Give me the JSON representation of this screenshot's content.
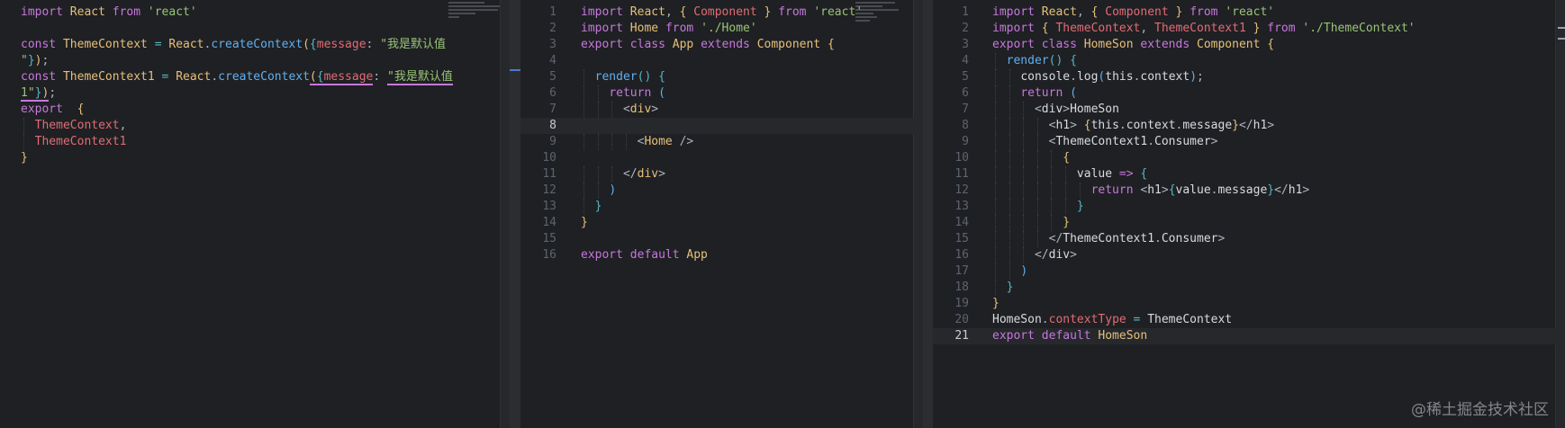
{
  "pane1": {
    "lines": [
      {
        "n": "",
        "seg": [
          [
            "k",
            "import "
          ],
          [
            "i",
            "React "
          ],
          [
            "k",
            "from "
          ],
          [
            "s",
            "'react'"
          ]
        ]
      },
      {
        "n": "",
        "seg": []
      },
      {
        "n": "",
        "seg": [
          [
            "k",
            "const "
          ],
          [
            "i",
            "ThemeContext "
          ],
          [
            "o",
            "= "
          ],
          [
            "i",
            "React"
          ],
          [
            "w",
            "."
          ],
          [
            "f",
            "createContext"
          ],
          [
            "p",
            "("
          ],
          [
            "b",
            "{"
          ],
          [
            "v",
            "message"
          ],
          [
            "w",
            ": "
          ],
          [
            "s",
            "\"我是默认值"
          ]
        ]
      },
      {
        "n": "",
        "seg": [
          [
            "s",
            "\""
          ],
          [
            "b",
            "}"
          ],
          [
            "p",
            ")"
          ],
          [
            "w",
            ";"
          ]
        ]
      },
      {
        "n": "",
        "seg": [
          [
            "k",
            "const "
          ],
          [
            "i",
            "ThemeContext1 "
          ],
          [
            "o",
            "= "
          ],
          [
            "i",
            "React"
          ],
          [
            "w",
            "."
          ],
          [
            "f",
            "createContext"
          ],
          [
            "p",
            "("
          ],
          [
            "b",
            "{"
          ],
          [
            "v",
            "message"
          ],
          [
            "w",
            ": "
          ],
          [
            "s",
            "\"我是默认值"
          ]
        ]
      },
      {
        "n": "",
        "seg": [
          [
            "s",
            "1\""
          ],
          [
            "b",
            "}"
          ],
          [
            "p",
            ")"
          ],
          [
            "w",
            ";"
          ]
        ]
      },
      {
        "n": "",
        "seg": [
          [
            "k",
            "export "
          ],
          [
            "w",
            " "
          ],
          [
            "p",
            "{"
          ]
        ]
      },
      {
        "n": "",
        "seg": [
          [
            "w",
            "  "
          ],
          [
            "v",
            "ThemeContext"
          ],
          [
            "w",
            ","
          ]
        ]
      },
      {
        "n": "",
        "seg": [
          [
            "w",
            "  "
          ],
          [
            "v",
            "ThemeContext1"
          ]
        ]
      },
      {
        "n": "",
        "seg": [
          [
            "p",
            "}"
          ]
        ]
      }
    ]
  },
  "pane2": {
    "lines": [
      {
        "n": "1",
        "seg": [
          [
            "k",
            "import "
          ],
          [
            "i",
            "React"
          ],
          [
            "w",
            ", "
          ],
          [
            "p",
            "{ "
          ],
          [
            "v",
            "Component "
          ],
          [
            "p",
            "} "
          ],
          [
            "k",
            "from "
          ],
          [
            "s",
            "'react'"
          ]
        ]
      },
      {
        "n": "2",
        "seg": [
          [
            "k",
            "import "
          ],
          [
            "i",
            "Home "
          ],
          [
            "k",
            "from "
          ],
          [
            "s",
            "'./Home'"
          ]
        ]
      },
      {
        "n": "3",
        "seg": [
          [
            "k",
            "export class "
          ],
          [
            "i",
            "App "
          ],
          [
            "k",
            "extends "
          ],
          [
            "i",
            "Component "
          ],
          [
            "p",
            "{"
          ]
        ]
      },
      {
        "n": "4",
        "seg": []
      },
      {
        "n": "5",
        "seg": [
          [
            "w",
            "  "
          ],
          [
            "f",
            "render"
          ],
          [
            "b",
            "() "
          ],
          [
            "b",
            "{"
          ]
        ]
      },
      {
        "n": "6",
        "seg": [
          [
            "w",
            "    "
          ],
          [
            "k",
            "return "
          ],
          [
            "f",
            "("
          ]
        ]
      },
      {
        "n": "7",
        "seg": [
          [
            "w",
            "      "
          ],
          [
            "w",
            "<"
          ],
          [
            "i",
            "div"
          ],
          [
            "w",
            ">"
          ]
        ]
      },
      {
        "n": "8",
        "seg": []
      },
      {
        "n": "9",
        "seg": [
          [
            "w",
            "        "
          ],
          [
            "w",
            "<"
          ],
          [
            "i",
            "Home "
          ],
          [
            "w",
            "/>"
          ]
        ]
      },
      {
        "n": "10",
        "seg": []
      },
      {
        "n": "11",
        "seg": [
          [
            "w",
            "      "
          ],
          [
            "w",
            "</"
          ],
          [
            "i",
            "div"
          ],
          [
            "w",
            ">"
          ]
        ]
      },
      {
        "n": "12",
        "seg": [
          [
            "w",
            "    "
          ],
          [
            "f",
            ")"
          ]
        ]
      },
      {
        "n": "13",
        "seg": [
          [
            "w",
            "  "
          ],
          [
            "b",
            "}"
          ]
        ]
      },
      {
        "n": "14",
        "seg": [
          [
            "p",
            "}"
          ]
        ]
      },
      {
        "n": "15",
        "seg": []
      },
      {
        "n": "16",
        "seg": [
          [
            "k",
            "export default "
          ],
          [
            "i",
            "App"
          ]
        ]
      }
    ],
    "current_line": 8
  },
  "pane3": {
    "lines": [
      {
        "n": "1",
        "seg": [
          [
            "k",
            "import "
          ],
          [
            "i",
            "React"
          ],
          [
            "w",
            ", "
          ],
          [
            "p",
            "{ "
          ],
          [
            "v",
            "Component "
          ],
          [
            "p",
            "} "
          ],
          [
            "k",
            "from "
          ],
          [
            "s",
            "'react'"
          ]
        ]
      },
      {
        "n": "2",
        "seg": [
          [
            "k",
            "import "
          ],
          [
            "p",
            "{ "
          ],
          [
            "v",
            "ThemeContext"
          ],
          [
            "w",
            ", "
          ],
          [
            "v",
            "ThemeContext1 "
          ],
          [
            "p",
            "} "
          ],
          [
            "k",
            "from "
          ],
          [
            "s",
            "'./ThemeContext'"
          ]
        ]
      },
      {
        "n": "3",
        "seg": [
          [
            "k",
            "export class "
          ],
          [
            "i",
            "HomeSon "
          ],
          [
            "k",
            "extends "
          ],
          [
            "i",
            "Component "
          ],
          [
            "p",
            "{"
          ]
        ]
      },
      {
        "n": "4",
        "seg": [
          [
            "w",
            "  "
          ],
          [
            "f",
            "render"
          ],
          [
            "b",
            "() "
          ],
          [
            "b",
            "{"
          ]
        ]
      },
      {
        "n": "5",
        "seg": [
          [
            "w",
            "    "
          ],
          [
            "t",
            "console"
          ],
          [
            "w",
            "."
          ],
          [
            "t",
            "log"
          ],
          [
            "f",
            "("
          ],
          [
            "t",
            "this"
          ],
          [
            "w",
            "."
          ],
          [
            "t",
            "context"
          ],
          [
            "f",
            ")"
          ],
          [
            "w",
            ";"
          ]
        ]
      },
      {
        "n": "6",
        "seg": [
          [
            "w",
            "    "
          ],
          [
            "k",
            "return "
          ],
          [
            "f",
            "("
          ]
        ]
      },
      {
        "n": "7",
        "seg": [
          [
            "w",
            "      "
          ],
          [
            "w",
            "<"
          ],
          [
            "t",
            "div"
          ],
          [
            "w",
            ">"
          ],
          [
            "t",
            "HomeSon"
          ]
        ]
      },
      {
        "n": "8",
        "seg": [
          [
            "w",
            "        "
          ],
          [
            "w",
            "<"
          ],
          [
            "t",
            "h1"
          ],
          [
            "w",
            "> "
          ],
          [
            "p",
            "{"
          ],
          [
            "t",
            "this"
          ],
          [
            "w",
            "."
          ],
          [
            "t",
            "context"
          ],
          [
            "w",
            "."
          ],
          [
            "t",
            "message"
          ],
          [
            "p",
            "}"
          ],
          [
            "w",
            "</"
          ],
          [
            "t",
            "h1"
          ],
          [
            "w",
            ">"
          ]
        ]
      },
      {
        "n": "9",
        "seg": [
          [
            "w",
            "        "
          ],
          [
            "w",
            "<"
          ],
          [
            "t",
            "ThemeContext1"
          ],
          [
            "w",
            "."
          ],
          [
            "t",
            "Consumer"
          ],
          [
            "w",
            ">"
          ]
        ]
      },
      {
        "n": "10",
        "seg": [
          [
            "w",
            "          "
          ],
          [
            "p",
            "{"
          ]
        ]
      },
      {
        "n": "11",
        "seg": [
          [
            "w",
            "            "
          ],
          [
            "t",
            "value "
          ],
          [
            "k",
            "=> "
          ],
          [
            "b",
            "{"
          ]
        ]
      },
      {
        "n": "12",
        "seg": [
          [
            "w",
            "              "
          ],
          [
            "k",
            "return "
          ],
          [
            "w",
            "<"
          ],
          [
            "t",
            "h1"
          ],
          [
            "w",
            ">"
          ],
          [
            "b",
            "{"
          ],
          [
            "t",
            "value"
          ],
          [
            "w",
            "."
          ],
          [
            "t",
            "message"
          ],
          [
            "b",
            "}"
          ],
          [
            "w",
            "</"
          ],
          [
            "t",
            "h1"
          ],
          [
            "w",
            ">"
          ]
        ]
      },
      {
        "n": "13",
        "seg": [
          [
            "w",
            "            "
          ],
          [
            "b",
            "}"
          ]
        ]
      },
      {
        "n": "14",
        "seg": [
          [
            "w",
            "          "
          ],
          [
            "p",
            "}"
          ]
        ]
      },
      {
        "n": "15",
        "seg": [
          [
            "w",
            "        "
          ],
          [
            "w",
            "</"
          ],
          [
            "t",
            "ThemeContext1"
          ],
          [
            "w",
            "."
          ],
          [
            "t",
            "Consumer"
          ],
          [
            "w",
            ">"
          ]
        ]
      },
      {
        "n": "16",
        "seg": [
          [
            "w",
            "      "
          ],
          [
            "w",
            "</"
          ],
          [
            "t",
            "div"
          ],
          [
            "w",
            ">"
          ]
        ]
      },
      {
        "n": "17",
        "seg": [
          [
            "w",
            "    "
          ],
          [
            "f",
            ")"
          ]
        ]
      },
      {
        "n": "18",
        "seg": [
          [
            "w",
            "  "
          ],
          [
            "b",
            "}"
          ]
        ]
      },
      {
        "n": "19",
        "seg": [
          [
            "p",
            "}"
          ]
        ]
      },
      {
        "n": "20",
        "seg": [
          [
            "t",
            "HomeSon"
          ],
          [
            "w",
            "."
          ],
          [
            "v",
            "contextType "
          ],
          [
            "o",
            "= "
          ],
          [
            "t",
            "ThemeContext"
          ]
        ]
      },
      {
        "n": "21",
        "seg": [
          [
            "k",
            "export default "
          ],
          [
            "i",
            "HomeSon"
          ]
        ]
      }
    ],
    "current_line": 21
  },
  "watermark": "@稀土掘金技术社区"
}
